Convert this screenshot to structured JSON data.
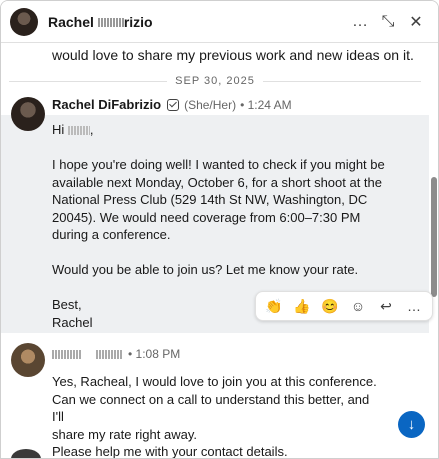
{
  "header": {
    "contact_name": "Rachel ",
    "contact_name_tail": "rizio",
    "more_label": "…",
    "minimize_label": "⤡",
    "close_label": "✕"
  },
  "feed": {
    "continuation_text": "would love to share my previous work and new ideas on it.",
    "date_separator": "SEP 30, 2025",
    "messages": [
      {
        "sender": "Rachel DiFabrizio",
        "pronouns": "(She/Her)",
        "time": "• 1:24 AM",
        "greeting": "Hi ",
        "greeting_tail": ",",
        "paragraphs": [
          "I hope you're doing well! I wanted to check if you might be available next Monday, October 6, for a short shoot at the National Press Club (529 14th St NW, Washington, DC 20045). We would need coverage from 6:00–7:30 PM during a conference.",
          "Would you be able to join us? Let me know your rate."
        ],
        "signoff": "Best,",
        "signature": "Rachel"
      },
      {
        "time": "• 1:08 PM",
        "lines": [
          "Yes, Racheal, I would love to join you at this conference.",
          "Can we connect on a call to understand this better, and I'll",
          "share my rate right away.",
          "Please help me with your contact details."
        ]
      }
    ]
  },
  "reactions": {
    "emojis": [
      "👏",
      "👍",
      "😊",
      "☺",
      "↩",
      "…"
    ]
  },
  "jump_button": "↓",
  "colors": {
    "accent": "#0a66c2",
    "message_highlight": "#eef0f2"
  }
}
